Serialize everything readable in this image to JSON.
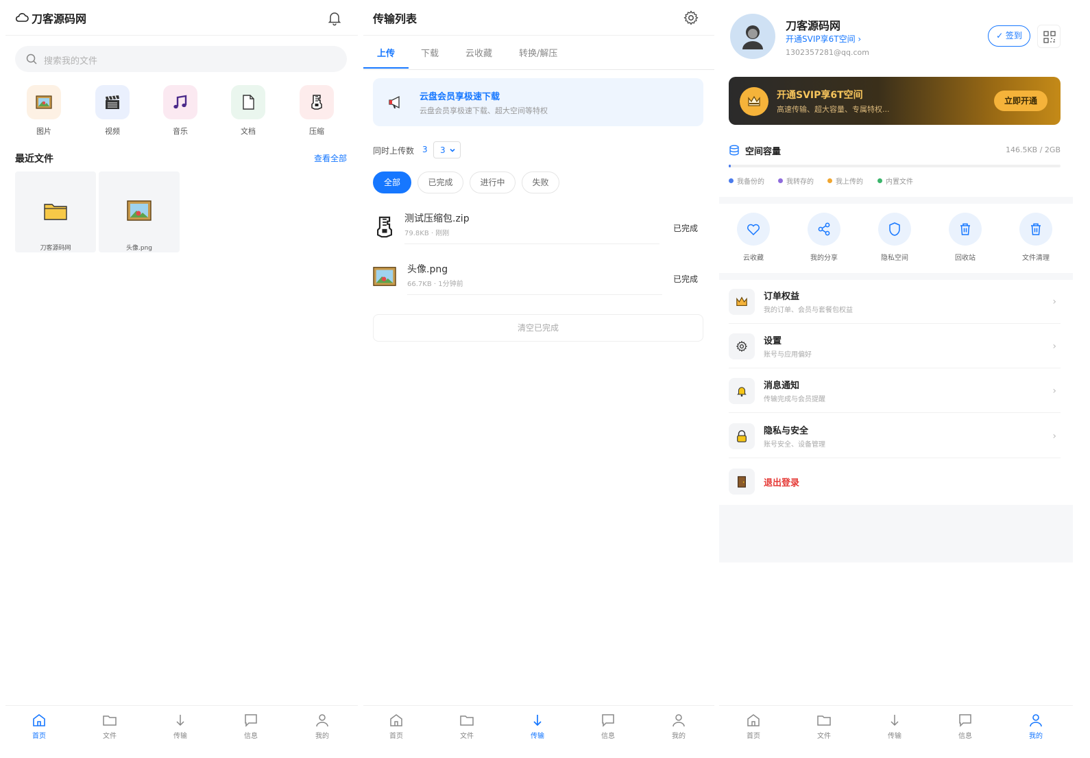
{
  "screen1": {
    "app_title": "刀客源码网",
    "search_placeholder": "搜索我的文件",
    "categories": [
      {
        "label": "图片",
        "icon": "image-icon",
        "bg": "#fdf1e4"
      },
      {
        "label": "视频",
        "icon": "clapper-icon",
        "bg": "#eaf0fd"
      },
      {
        "label": "音乐",
        "icon": "music-icon",
        "bg": "#fbe9f1"
      },
      {
        "label": "文档",
        "icon": "document-icon",
        "bg": "#eaf6ee"
      },
      {
        "label": "压缩",
        "icon": "archive-icon",
        "bg": "#fdecec"
      }
    ],
    "recent_title": "最近文件",
    "view_all": "查看全部",
    "recent_files": [
      {
        "name": "刀客源码网",
        "icon": "folder-icon"
      },
      {
        "name": "头像.png",
        "icon": "image-icon"
      }
    ]
  },
  "screen2": {
    "title": "传输列表",
    "tabs": [
      "上传",
      "下载",
      "云收藏",
      "转换/解压"
    ],
    "active_tab": "上传",
    "promo": {
      "title": "云盘会员享极速下载",
      "subtitle": "云盘会员享极速下载、超大空间等特权"
    },
    "concurrency": {
      "label": "同时上传数",
      "value": "3",
      "selected": "3"
    },
    "filters": [
      "全部",
      "已完成",
      "进行中",
      "失败"
    ],
    "active_filter": "全部",
    "transfers": [
      {
        "name": "测试压缩包.zip",
        "meta": "79.8KB · 刚刚",
        "status": "已完成",
        "icon": "archive-icon"
      },
      {
        "name": "头像.png",
        "meta": "66.7KB · 1分钟前",
        "status": "已完成",
        "icon": "image-icon"
      }
    ],
    "clear_label": "清空已完成"
  },
  "screen3": {
    "user_name": "刀客源码网",
    "vip_link": "开通SVIP享6T空间 ›",
    "email": "1302357281@qq.com",
    "checkin_label": "✓ 签到",
    "banner": {
      "title": "开通SVIP享6T空间",
      "subtitle": "高速传输、超大容量、专属特权...",
      "button": "立即开通"
    },
    "space": {
      "title": "空间容量",
      "value": "146.5KB / 2GB",
      "used_fraction": 0.0001
    },
    "legend": [
      {
        "label": "我备份的",
        "color": "#4a7bec"
      },
      {
        "label": "我转存的",
        "color": "#8e6bdc"
      },
      {
        "label": "我上传的",
        "color": "#f0a630"
      },
      {
        "label": "内置文件",
        "color": "#3bb56b"
      }
    ],
    "quick_actions": [
      {
        "label": "云收藏",
        "icon": "heart-icon"
      },
      {
        "label": "我的分享",
        "icon": "share-icon"
      },
      {
        "label": "隐私空间",
        "icon": "shield-icon"
      },
      {
        "label": "回收站",
        "icon": "trash-icon"
      },
      {
        "label": "文件清理",
        "icon": "trash-icon"
      }
    ],
    "menu": [
      {
        "title": "订单权益",
        "subtitle": "我的订单、会员与套餐包权益",
        "icon": "crown-icon"
      },
      {
        "title": "设置",
        "subtitle": "账号与应用偏好",
        "icon": "gear-icon"
      },
      {
        "title": "消息通知",
        "subtitle": "传输完成与会员提醒",
        "icon": "bell-icon"
      },
      {
        "title": "隐私与安全",
        "subtitle": "账号安全、设备管理",
        "icon": "lock-icon"
      }
    ],
    "logout": "退出登录"
  },
  "tabbar": [
    "首页",
    "文件",
    "传输",
    "信息",
    "我的"
  ],
  "colors": {
    "accent": "#1677ff",
    "danger": "#e53935",
    "gold": "#f5b33a"
  }
}
